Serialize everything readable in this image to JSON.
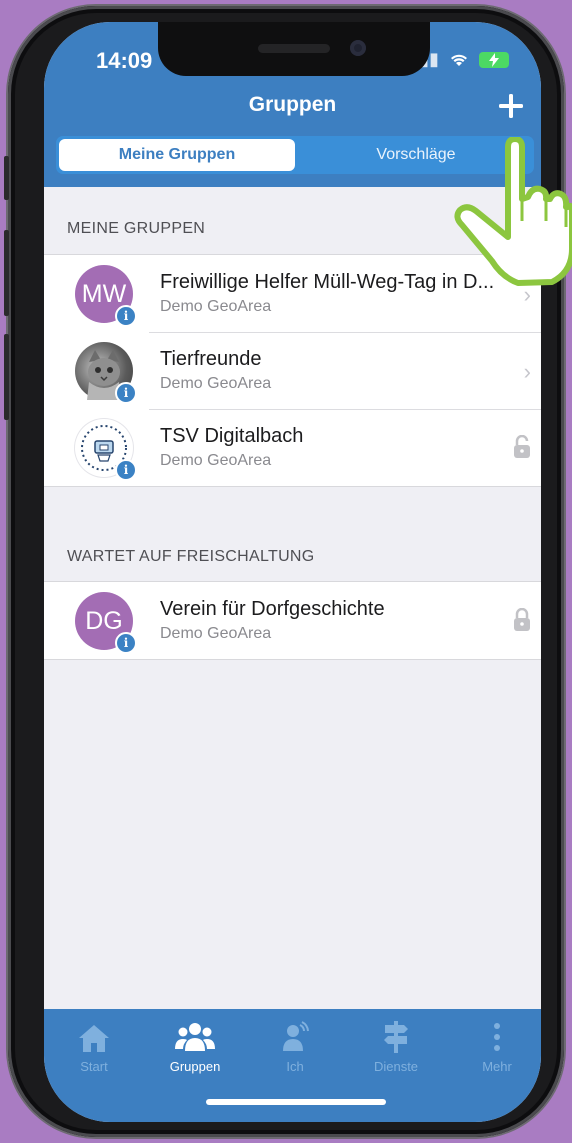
{
  "status_bar": {
    "time": "14:09"
  },
  "nav": {
    "title": "Gruppen",
    "add_icon": "plus-icon"
  },
  "segmented": {
    "tabs": [
      "Meine Gruppen",
      "Vorschläge"
    ],
    "selected": 0
  },
  "sections": [
    {
      "header": "MEINE GRUPPEN",
      "items": [
        {
          "initials": "MW",
          "title": "Freiwillige Helfer Müll-Weg-Tag in D...",
          "subtitle": "Demo GeoArea",
          "accessory": "chevron-right-icon"
        },
        {
          "initials": "",
          "title": "Tierfreunde",
          "subtitle": "Demo GeoArea",
          "accessory": "chevron-right-icon"
        },
        {
          "initials": "",
          "title": "TSV Digitalbach",
          "subtitle": "Demo GeoArea",
          "accessory": "lock-icon"
        }
      ]
    },
    {
      "header": "WARTET AUF FREISCHALTUNG",
      "items": [
        {
          "initials": "DG",
          "title": "Verein für Dorfgeschichte",
          "subtitle": "Demo GeoArea",
          "accessory": "lock-icon"
        }
      ]
    }
  ],
  "tabbar": {
    "items": [
      {
        "label": "Start",
        "icon": "home-icon"
      },
      {
        "label": "Gruppen",
        "icon": "group-icon"
      },
      {
        "label": "Ich",
        "icon": "person-icon"
      },
      {
        "label": "Dienste",
        "icon": "signpost-icon"
      },
      {
        "label": "Mehr",
        "icon": "more-icon"
      }
    ],
    "selected": 1
  },
  "colors": {
    "accent": "#3d7fc1",
    "avatar": "#a36db4",
    "background": "#efeff4"
  }
}
